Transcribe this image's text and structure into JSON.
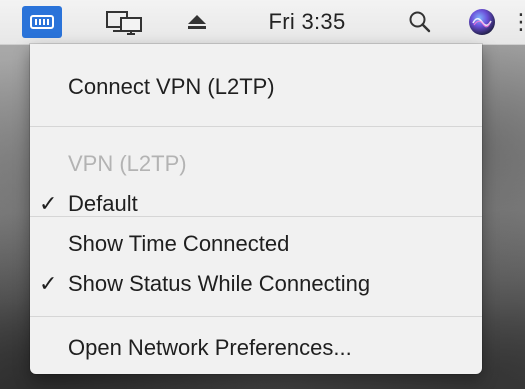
{
  "menubar": {
    "status_icons": [
      "vpn-status-icon",
      "displays-icon",
      "eject-icon"
    ],
    "clock": "Fri 3:35",
    "right_icons": [
      "search-icon",
      "siri-icon"
    ],
    "overflow": "⋮"
  },
  "menu": {
    "connect": "Connect VPN (L2TP)",
    "section_header": "VPN (L2TP)",
    "default_config": "Default",
    "default_checked": "✓",
    "show_time": "Show Time Connected",
    "show_status": "Show Status While Connecting",
    "show_status_checked": "✓",
    "open_prefs": "Open Network Preferences..."
  },
  "colors": {
    "accent": "#2a73d9",
    "menu_bg": "#f1f1f1",
    "disabled_text": "#b3b3b3"
  }
}
